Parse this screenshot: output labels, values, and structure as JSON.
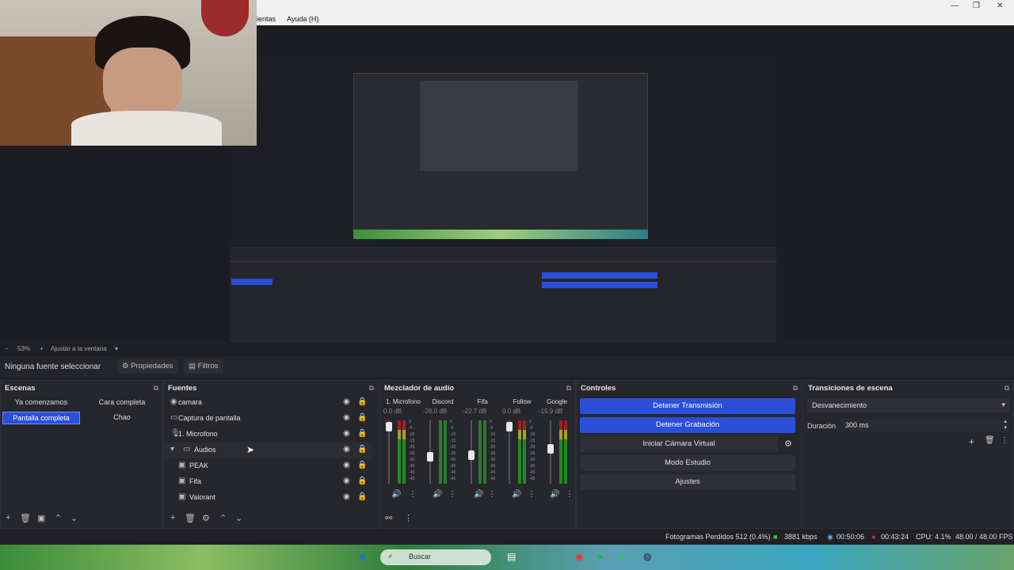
{
  "window": {
    "menu": [
      "ientas",
      "Ayuda (H)"
    ],
    "controls": [
      "—",
      "❐",
      "✕"
    ]
  },
  "zoombar": {
    "zoom": "53%",
    "fit_label": "Ajustar a la ventana"
  },
  "propbar": {
    "no_source": "Ninguna fuente seleccionar",
    "properties": "Propiedades",
    "filters": "Filtros"
  },
  "scenes": {
    "title": "Escenas",
    "items": [
      "Ya comenzamos",
      "Cara completa",
      "Pantalla completa",
      "Chao"
    ],
    "active": "Pantalla completa"
  },
  "sources": {
    "title": "Fuentes",
    "items": [
      {
        "name": "camara",
        "icon": "camera-icon"
      },
      {
        "name": "Captura de pantalla",
        "icon": "monitor-icon"
      },
      {
        "name": "1. Microfono",
        "icon": "microphone-icon"
      },
      {
        "name": "Audios",
        "icon": "folder-icon"
      },
      {
        "name": "PEAK",
        "icon": "media-icon"
      },
      {
        "name": "Fifa",
        "icon": "media-icon"
      },
      {
        "name": "Valorant",
        "icon": "media-icon"
      }
    ]
  },
  "mixer": {
    "title": "Mezclador de audio",
    "channels": [
      {
        "name": "1. Microfono",
        "db": "0.0 dB"
      },
      {
        "name": "Discord",
        "db": "-26.0 dB"
      },
      {
        "name": "Fifa",
        "db": "-22.7 dB"
      },
      {
        "name": "Follow",
        "db": "0.0 dB"
      },
      {
        "name": "Google",
        "db": "-15.9 dB"
      }
    ],
    "ticks": [
      "0",
      "-5",
      "-10",
      "-15",
      "-20",
      "-25",
      "-30",
      "-35",
      "-40",
      "-45",
      "-50",
      "-55",
      "-60"
    ]
  },
  "controls": {
    "title": "Controles",
    "stop_stream": "Detener Transmisión",
    "stop_record": "Detener Grabación",
    "virtual_cam": "Iniciar Cámara Virtual",
    "studio_mode": "Modo Estudio",
    "settings": "Ajustes"
  },
  "transitions": {
    "title": "Transiciones de escena",
    "selected": "Desvanecimiento",
    "duration_label": "Duración",
    "duration_value": "300 ms"
  },
  "status": {
    "dropped": "Fotogramas Perdidos 512 (0.4%)",
    "bitrate": "3881 kbps",
    "stream_time": "00:50:06",
    "rec_time": "00:43:24",
    "cpu": "CPU: 4.1%",
    "fps": "48.00 / 48.00 FPS"
  },
  "taskbar": {
    "search": "Buscar"
  },
  "colors": {
    "accent": "#2b4fd9",
    "dock_bg": "#26272d",
    "app_bg": "#1e1f24"
  }
}
